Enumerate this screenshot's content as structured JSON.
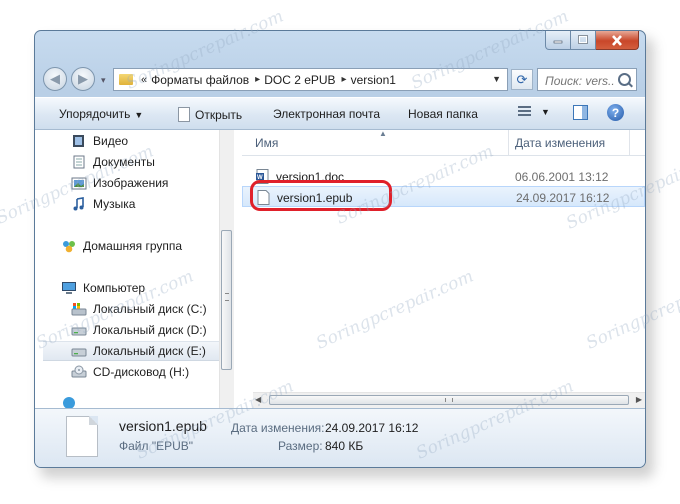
{
  "window": {
    "caption_buttons": [
      "minimize",
      "maximize",
      "close"
    ]
  },
  "address": {
    "overflow": "«",
    "crumbs": [
      "Форматы файлов",
      "DOC 2 ePUB",
      "version1"
    ],
    "search_placeholder": "Поиск: vers..."
  },
  "toolbar": {
    "organize": "Упорядочить",
    "open": "Открыть",
    "email": "Электронная почта",
    "new_folder": "Новая папка"
  },
  "nav": {
    "items": [
      {
        "label": "Видео",
        "icon": "video-library-icon"
      },
      {
        "label": "Документы",
        "icon": "documents-library-icon"
      },
      {
        "label": "Изображения",
        "icon": "pictures-library-icon"
      },
      {
        "label": "Музыка",
        "icon": "music-library-icon"
      },
      {
        "label": "Домашняя группа",
        "icon": "homegroup-icon"
      },
      {
        "label": "Компьютер",
        "icon": "computer-icon"
      },
      {
        "label": "Локальный диск (C:)",
        "icon": "system-drive-icon"
      },
      {
        "label": "Локальный диск (D:)",
        "icon": "drive-icon"
      },
      {
        "label": "Локальный диск (E:)",
        "icon": "drive-icon",
        "selected": true
      },
      {
        "label": "CD-дисковод (H:)",
        "icon": "cd-drive-icon"
      }
    ]
  },
  "files": {
    "col_name": "Имя",
    "col_date": "Дата изменения",
    "rows": [
      {
        "name": "version1.doc",
        "date": "06.06.2001 13:12",
        "icon": "word-document-icon"
      },
      {
        "name": "version1.epub",
        "date": "24.09.2017 16:12",
        "icon": "generic-file-icon",
        "selected": true
      }
    ]
  },
  "details": {
    "name": "version1.epub",
    "type": "Файл \"EPUB\"",
    "modified_label": "Дата изменения:",
    "modified_value": "24.09.2017 16:12",
    "size_label": "Размер:",
    "size_value": "840 КБ"
  },
  "watermark": "Soringpcrepair.com",
  "colors": {
    "highlight_ring": "#e0202a",
    "selection": "#d6e8fb",
    "chrome": "#b9cfe6"
  }
}
